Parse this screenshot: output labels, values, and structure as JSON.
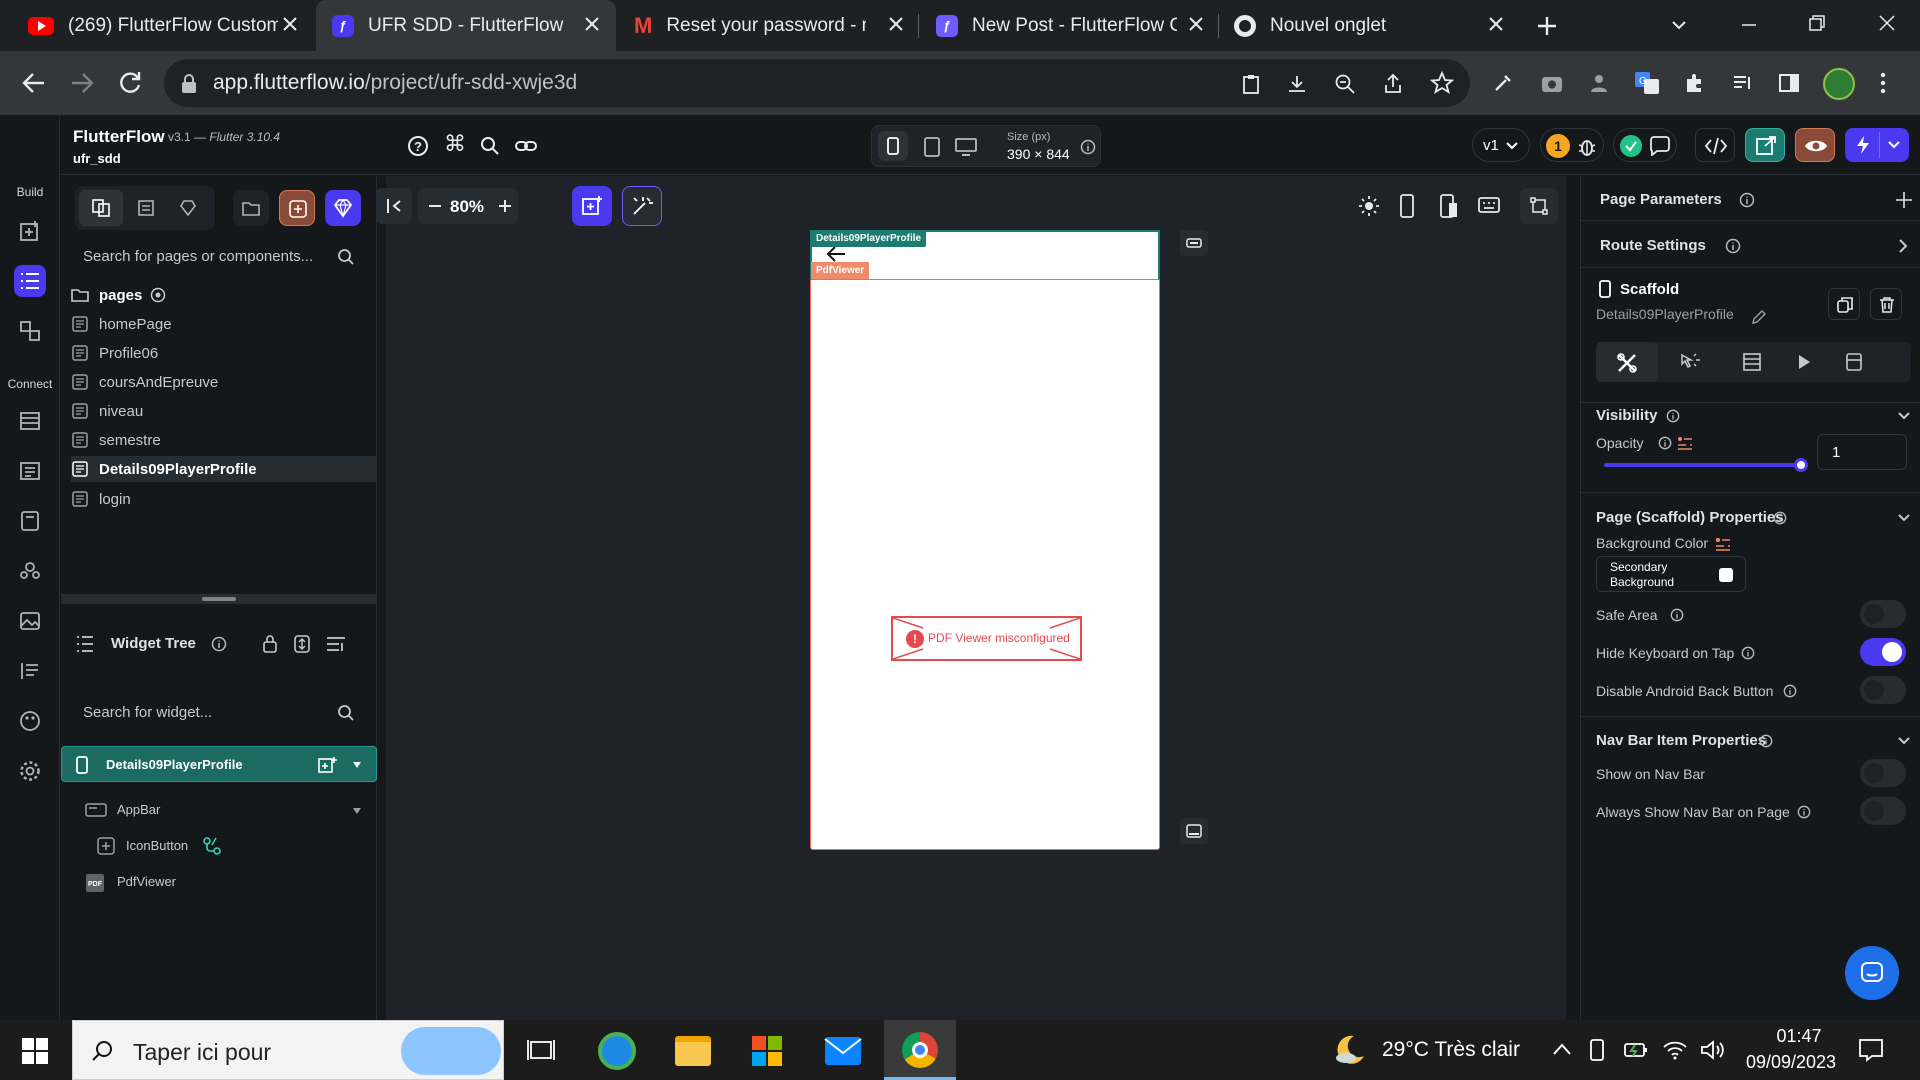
{
  "browser": {
    "tabs": [
      {
        "title": "(269) FlutterFlow Custom",
        "icon": "youtube-icon"
      },
      {
        "title": "UFR SDD - FlutterFlow",
        "icon": "flutterflow-icon"
      },
      {
        "title": "Reset your password - mo",
        "icon": "gmail-icon"
      },
      {
        "title": "New Post - FlutterFlow Co",
        "icon": "flutterflow-icon"
      },
      {
        "title": "Nouvel onglet",
        "icon": "chrome-icon"
      }
    ],
    "url_host": "app.flutterflow.io",
    "url_path": "/project/ufr-sdd-xwje3d"
  },
  "ff": {
    "brand": "FlutterFlow",
    "version": "v3.1 — ",
    "flutter": "Flutter 3.10.4",
    "project": "ufr_sdd",
    "size_label": "Size (px)",
    "size_value": "390 × 844",
    "version_select": "v1",
    "warning_count": "1",
    "zoom": "80%"
  },
  "rail": {
    "build": "Build",
    "connect": "Connect"
  },
  "left_panel": {
    "search_pages": "Search for pages or components...",
    "pages_label": "pages",
    "pages": [
      "homePage",
      "Profile06",
      "coursAndEpreuve",
      "niveau",
      "semestre",
      "Details09PlayerProfile",
      "login"
    ],
    "widget_tree_label": "Widget Tree",
    "search_widget": "Search for widget...",
    "tree": {
      "root": "Details09PlayerProfile",
      "appbar": "AppBar",
      "iconbutton": "IconButton",
      "pdfviewer": "PdfViewer"
    }
  },
  "canvas": {
    "page_tag": "Details09PlayerProfile",
    "widget_tag": "PdfViewer",
    "error": "PDF Viewer misconfigured"
  },
  "right_panel": {
    "page_parameters": "Page Parameters",
    "route_settings": "Route Settings",
    "scaffold": "Scaffold",
    "scaffold_name": "Details09PlayerProfile",
    "visibility": "Visibility",
    "opacity": "Opacity",
    "opacity_value": "1",
    "opacity_level": 1,
    "page_props": "Page (Scaffold) Properties",
    "bg_color_label": "Background Color",
    "bg_color_value": "Secondary Background",
    "safe_area": "Safe Area",
    "hide_keyboard": "Hide Keyboard on Tap",
    "disable_back": "Disable Android Back Button",
    "nav_props": "Nav Bar Item Properties",
    "show_nav": "Show on Nav Bar",
    "always_nav": "Always Show Nav Bar on Page"
  },
  "taskbar": {
    "search": "Taper ici pour",
    "weather": "29°C  Très clair",
    "time": "01:47",
    "date": "09/09/2023"
  },
  "colors": {
    "accent": "#4b39ef",
    "teal": "#1c7c72",
    "orange": "#ef6c4f",
    "error": "#e5484d"
  }
}
